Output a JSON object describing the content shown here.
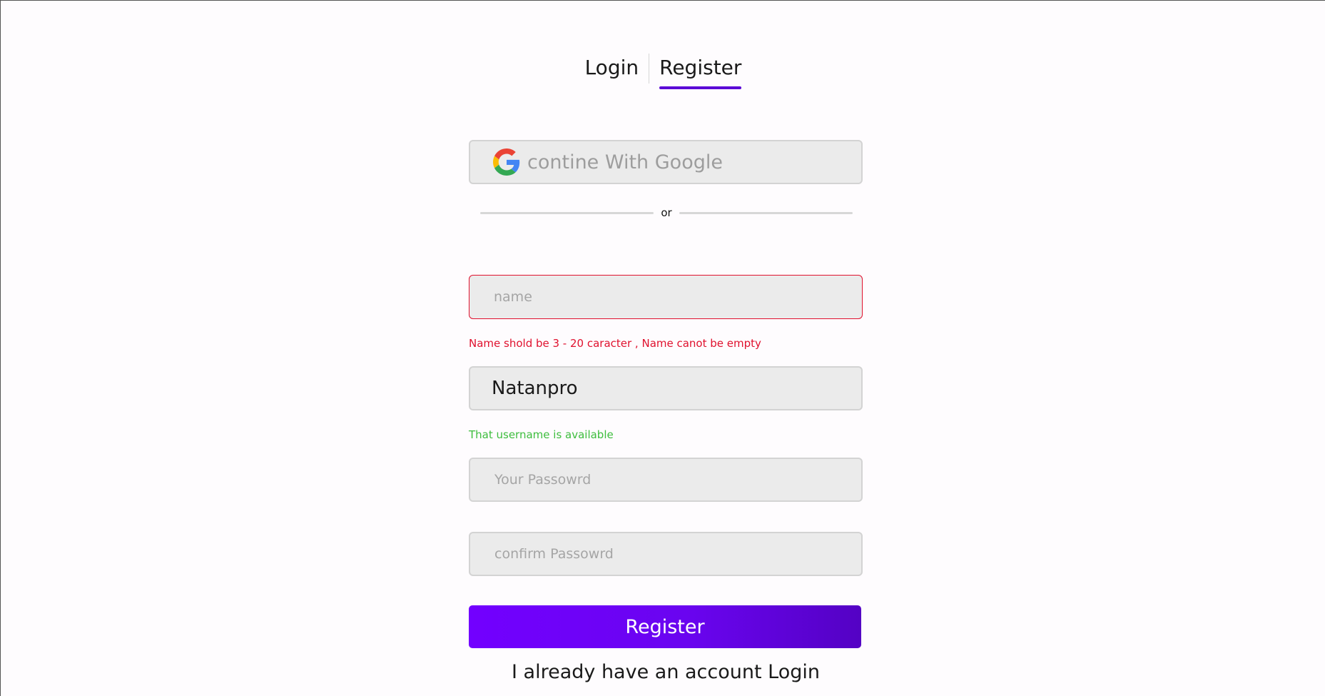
{
  "tabs": {
    "login_label": "Login",
    "register_label": "Register",
    "active": "Register"
  },
  "google": {
    "label": "contine With Google",
    "icon": "google-g-icon"
  },
  "divider": {
    "label": "or"
  },
  "name_field": {
    "value": "",
    "placeholder": "name",
    "error": "Name shold be 3 - 20 caracter , Name canot be empty"
  },
  "username_field": {
    "value": "Natanpro",
    "placeholder": "",
    "status": "That username is available"
  },
  "password_field": {
    "value": "",
    "placeholder": "Your Passowrd"
  },
  "confirm_field": {
    "value": "",
    "placeholder": "confirm Passowrd"
  },
  "submit": {
    "label": "Register"
  },
  "footer": {
    "switch_text": "I already have an account Login"
  },
  "colors": {
    "accent": "#5b06d6",
    "button_gradient_start": "#7200ff",
    "button_gradient_end": "#5402c4",
    "error": "#e0112e",
    "success": "#3dbd3d",
    "field_bg": "#ebebeb"
  }
}
